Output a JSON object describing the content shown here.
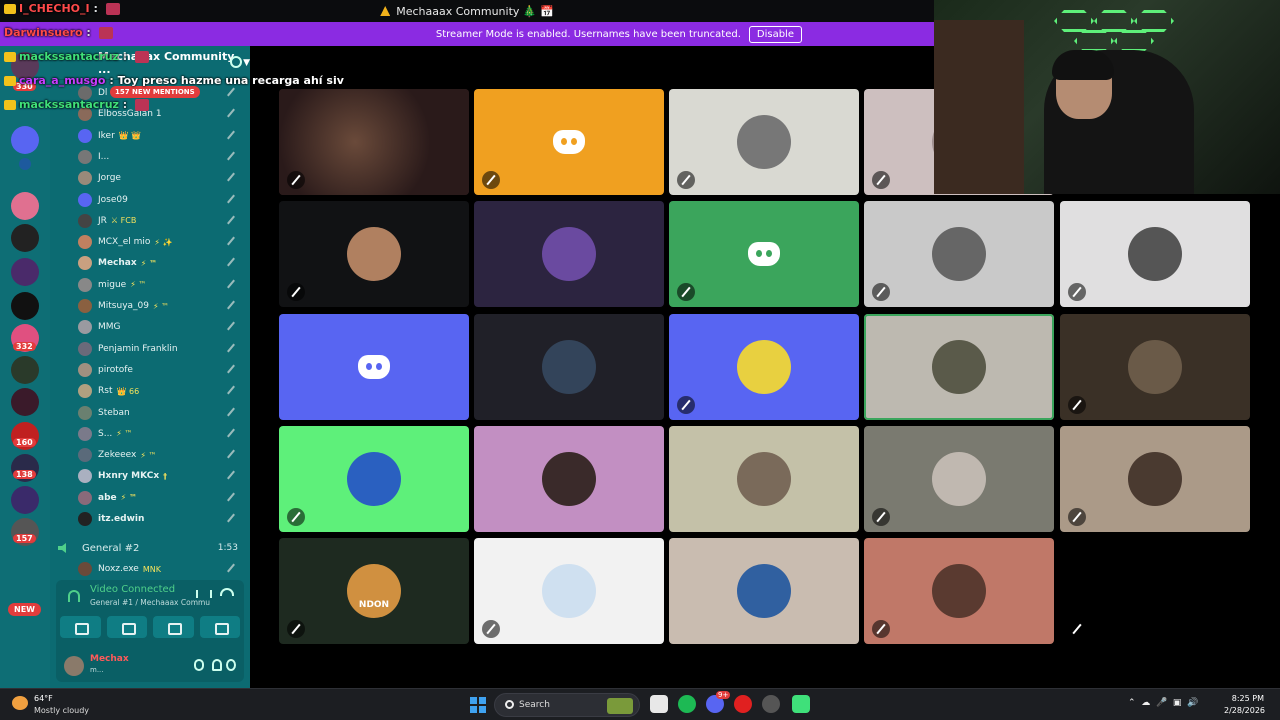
{
  "window": {
    "title": "Mechaaax Community 🎄 📅",
    "streamer_banner": "Streamer Mode is enabled. Usernames have been truncated.",
    "disable_label": "Disable"
  },
  "chat_overlay": [
    {
      "user": "I_CHECHO_I",
      "message": "",
      "color": "#ff4a4a"
    },
    {
      "user": "Darwinsuero",
      "message": "",
      "color": "#ff4a4a"
    },
    {
      "user": "mackssantacruz",
      "message": "",
      "color": "#3fe07a"
    },
    {
      "user": "cara_a_musgo",
      "message": "Toy preso hazme una recarga ahí siv",
      "color": "#c83cff"
    },
    {
      "user": "mackssantacruz",
      "message": "",
      "color": "#3fe07a"
    }
  ],
  "rail": {
    "badges": [
      "330",
      "332",
      "160",
      "138",
      "157"
    ],
    "new_label": "NEW"
  },
  "sidebar": {
    "server_name": "Mechaaax Community ...",
    "mentions": "157 NEW MENTIONS",
    "members": [
      {
        "name": "Dl",
        "tags": "",
        "avatar": "#6b6b6b"
      },
      {
        "name": "ElbossGalan 1",
        "tags": "",
        "avatar": "#8a6a5a"
      },
      {
        "name": "Iker",
        "tags": "👑 👑",
        "avatar": "#5865f2"
      },
      {
        "name": "I...",
        "tags": "",
        "avatar": "#777"
      },
      {
        "name": "Jorge",
        "tags": "",
        "avatar": "#9a8a7a"
      },
      {
        "name": "Jose09",
        "tags": "",
        "avatar": "#5865f2"
      },
      {
        "name": "JR",
        "tags": "⚔ FCB",
        "avatar": "#444"
      },
      {
        "name": "MCX_el mio",
        "tags": "⚡ ✨",
        "avatar": "#c08060"
      },
      {
        "name": "Mechax",
        "tags": "⚡ ™",
        "avatar": "#c9a080"
      },
      {
        "name": "migue",
        "tags": "⚡ ™",
        "avatar": "#888"
      },
      {
        "name": "Mitsuya_09",
        "tags": "⚡ ™",
        "avatar": "#8a6040"
      },
      {
        "name": "MMG",
        "tags": "",
        "avatar": "#9a9aa0"
      },
      {
        "name": "Penjamin Franklin",
        "tags": "",
        "avatar": "#6a6a7a"
      },
      {
        "name": "pirotofe",
        "tags": "",
        "avatar": "#a09080"
      },
      {
        "name": "Rst",
        "tags": "👑 66",
        "avatar": "#b0a080"
      },
      {
        "name": "Steban",
        "tags": "",
        "avatar": "#6a8070"
      },
      {
        "name": "S...",
        "tags": "⚡ ™",
        "avatar": "#7a7a8a"
      },
      {
        "name": "Zekeeex",
        "tags": "⚡ ™",
        "avatar": "#5a6a7a"
      },
      {
        "name": "Hxnry MKCx",
        "tags": "†",
        "avatar": "#aab0c0"
      },
      {
        "name": "abe",
        "tags": "⚡ ™",
        "avatar": "#8a6a7a"
      },
      {
        "name": "itz.edwin",
        "tags": "",
        "avatar": "#222"
      }
    ],
    "voice_channel": {
      "name": "General #2",
      "timer": "1:53"
    },
    "voice_member": {
      "name": "Noxz.exe",
      "tags": "MNK"
    }
  },
  "voice_panel": {
    "status": "Video Connected",
    "channel": "General #1 / Mechaaax Communit...",
    "username": "Mechax",
    "user_status": "m..."
  },
  "tiles": [
    {
      "kind": "video",
      "bg": "#2a1a1a",
      "muted": true
    },
    {
      "kind": "discord",
      "bg": "#f0a020",
      "muted": true
    },
    {
      "kind": "avatar",
      "bg": "#d9d9d2",
      "avatar": "#777",
      "muted": true
    },
    {
      "kind": "avatar",
      "bg": "#cdbfbf",
      "avatar": "#a09090",
      "muted": true
    },
    {
      "kind": "avatar",
      "bg": "#111214",
      "avatar": "#b08060",
      "muted": true
    },
    {
      "kind": "avatar",
      "bg": "#2c2440",
      "avatar": "#6a4aa0",
      "muted": false
    },
    {
      "kind": "discord",
      "bg": "#3ba55c",
      "muted": true
    },
    {
      "kind": "avatar",
      "bg": "#c9c9c9",
      "avatar": "#666",
      "muted": true
    },
    {
      "kind": "avatar",
      "bg": "#e0dfe0",
      "avatar": "#555",
      "muted": true
    },
    {
      "kind": "discord",
      "bg": "#5865f2",
      "muted": false
    },
    {
      "kind": "avatar",
      "bg": "#202028",
      "avatar": "#33445a",
      "muted": false
    },
    {
      "kind": "avatar",
      "bg": "#5865f2",
      "avatar": "#e8d040",
      "muted": true
    },
    {
      "kind": "avatar",
      "bg": "#bdb9b0",
      "avatar": "#5a5a4a",
      "muted": false,
      "speaking": true
    },
    {
      "kind": "avatar",
      "bg": "#3a3026",
      "avatar": "#6a5a48",
      "muted": true
    },
    {
      "kind": "avatar",
      "bg": "#5ef07a",
      "avatar": "#2a60c0",
      "muted": true
    },
    {
      "kind": "avatar",
      "bg": "#c28fc2",
      "avatar": "#3a2a2a",
      "muted": false
    },
    {
      "kind": "avatar",
      "bg": "#c4c1a8",
      "avatar": "#7a6a5a",
      "muted": false
    },
    {
      "kind": "avatar",
      "bg": "#7a7a70",
      "avatar": "#c0b8b0",
      "muted": true
    },
    {
      "kind": "avatar",
      "bg": "#ab9a88",
      "avatar": "#4a3a30",
      "muted": true
    },
    {
      "kind": "avatar",
      "bg": "#1e2a20",
      "avatar": "#d09040",
      "muted": true
    },
    {
      "kind": "avatar",
      "bg": "#f2f2f2",
      "avatar": "#cfe0f0",
      "muted": true
    },
    {
      "kind": "avatar",
      "bg": "#c9bcb0",
      "avatar": "#3060a0",
      "muted": false
    },
    {
      "kind": "avatar",
      "bg": "#c07868",
      "avatar": "#5a3a30",
      "muted": true
    },
    {
      "kind": "empty",
      "bg": "#000",
      "muted": true
    }
  ],
  "tile_text": {
    "avatar_caption": "NDON"
  },
  "taskbar": {
    "temp": "64°F",
    "condition": "Mostly cloudy",
    "search": "Search",
    "time": "8:25 PM",
    "date": "2/28/2026",
    "discord_badge": "9+"
  }
}
